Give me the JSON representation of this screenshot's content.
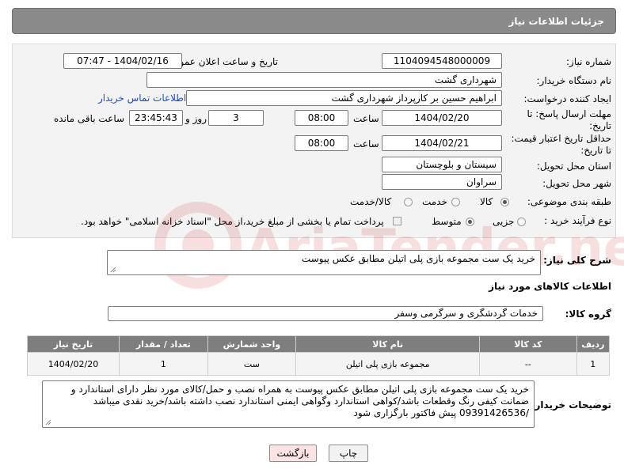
{
  "header": {
    "title": "جزئیات اطلاعات نیاز"
  },
  "form": {
    "need_number_label": "شماره نیاز:",
    "need_number": "1104094548000009",
    "announce_label": "تاریخ و ساعت اعلان عمومی:",
    "announce_value": "1404/02/16 - 07:47",
    "buyer_org_label": "نام دستگاه خریدار:",
    "buyer_org": "شهرداری گشت",
    "creator_label": "ایجاد کننده درخواست:",
    "creator": "ابراهیم حسین بر کارپرداز شهرداری گشت",
    "contact_link": "اطلاعات تماس خریدار",
    "deadline_label_1": "مهلت ارسال پاسخ: تا",
    "deadline_label_2": "تاریخ:",
    "deadline_date": "1404/02/20",
    "time_label": "ساعت",
    "deadline_time": "08:00",
    "days_value": "3",
    "days_label": "روز و",
    "remaining_time": "23:45:43",
    "remaining_label": "ساعت باقی مانده",
    "price_validity_label_1": "حداقل تاریخ اعتبار قیمت:",
    "price_validity_label_2": "تا تاریخ:",
    "price_validity_date": "1404/02/21",
    "price_validity_time": "08:00",
    "province_label": "استان محل تحویل:",
    "province": "سیستان و بلوچستان",
    "city_label": "شهر محل تحویل:",
    "city": "سراوان",
    "category_label": "طبقه بندی موضوعی:",
    "category_options": [
      "کالا",
      "خدمت",
      "کالا/خدمت"
    ],
    "category_selected": "کالا",
    "process_label": "نوع فرآیند خرید :",
    "process_options": [
      "جزیی",
      "متوسط"
    ],
    "process_selected": "متوسط",
    "payment_note": "پرداخت تمام یا بخشی از مبلغ خرید،از محل \"اسناد خزانه اسلامی\" خواهد بود."
  },
  "description": {
    "label": "شرح کلی نیاز:",
    "value": "خرید یک ست مجموعه بازی پلی اتیلن مطابق عکس پیوست"
  },
  "goods_section": {
    "title": "اطلاعات کالاهای مورد نیاز",
    "group_label": "گروه کالا:",
    "group_value": "خدمات گردشگری و سرگرمی وسفر",
    "columns": [
      "ردیف",
      "کد کالا",
      "نام کالا",
      "واحد شمارش",
      "تعداد / مقدار",
      "تاریخ نیاز"
    ],
    "rows": [
      [
        "1",
        "--",
        "مجموعه بازی پلی اتیلن",
        "ست",
        "1",
        "1404/02/20"
      ]
    ]
  },
  "buyer_notes": {
    "label": "توضیحات خریدار:",
    "value": "خرید یک ست مجموعه بازی پلی اتیلن مطابق عکس پیوست به همراه نصب و حمل/کالای مورد نظر دارای استاندارد و ضمانت کیفی رنگ وقطعات باشد/کواهی استاندارد وگواهی ایمنی  استاندارد نصب داشته باشد/خرید نقدی میباشد /09391426536 پیش فاکتور بارگزاری شود"
  },
  "buttons": {
    "print": "چاپ",
    "back": "بازگشت"
  },
  "watermark": {
    "text": "AriaTender.neT"
  },
  "colors": {
    "header_bg": "#8a8a8a",
    "table_header_bg": "#7e7e7e",
    "link": "#1a4fb5",
    "back_button_bg": "#fde3e3"
  }
}
